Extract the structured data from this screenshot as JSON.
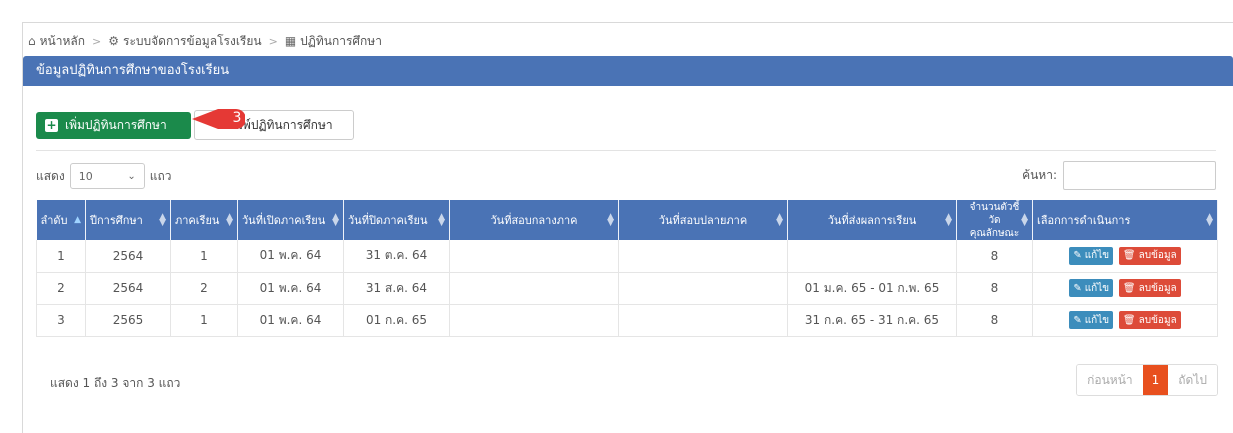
{
  "breadcrumb": [
    {
      "icon": "home-icon",
      "glyph": "⌂",
      "label": "หน้าหลัก"
    },
    {
      "icon": "gears-icon",
      "glyph": "⚙",
      "label": "ระบบจัดการข้อมูลโรงเรียน"
    },
    {
      "icon": "calendar-icon",
      "glyph": "▦",
      "label": "ปฏิทินการศึกษา"
    }
  ],
  "panel": {
    "title": "ข้อมูลปฏิทินการศึกษาของโรงเรียน"
  },
  "toolbar": {
    "add_label": "เพิ่มปฏิทินการศึกษา",
    "print_label": "มพ์ปฏิทินการศึกษา",
    "step_marker": "3"
  },
  "length": {
    "prefix": "แสดง",
    "value": "10",
    "suffix": "แถว"
  },
  "search": {
    "label": "ค้นหา:",
    "value": ""
  },
  "table": {
    "headers": [
      "ลำดับ",
      "ปีการศึกษา",
      "ภาคเรียน",
      "วันที่เปิดภาคเรียน",
      "วันที่ปิดภาคเรียน",
      "วันที่สอบกลางภาค",
      "วันที่สอบปลายภาค",
      "วันที่ส่งผลการเรียน",
      "จำนวนตัวชี้วัด คุณลักษณะ",
      "เลือกการดำเนินการ"
    ],
    "rows": [
      {
        "no": "1",
        "year": "2564",
        "term": "1",
        "open": "01 พ.ค. 64",
        "close": "31 ต.ค. 64",
        "midterm": "",
        "final": "",
        "grade_submit": "",
        "indicators": "8"
      },
      {
        "no": "2",
        "year": "2564",
        "term": "2",
        "open": "01 พ.ค. 64",
        "close": "31 ส.ค. 64",
        "midterm": "",
        "final": "",
        "grade_submit": "01 ม.ค. 65 - 01 ก.พ. 65",
        "indicators": "8"
      },
      {
        "no": "3",
        "year": "2565",
        "term": "1",
        "open": "01 พ.ค. 64",
        "close": "01 ก.ค. 65",
        "midterm": "",
        "final": "",
        "grade_submit": "31 ก.ค. 65 - 31 ก.ค. 65",
        "indicators": "8"
      }
    ],
    "edit_label": "แก้ไข",
    "delete_label": "ลบข้อมูล"
  },
  "info": "แสดง 1 ถึง 3 จาก 3 แถว",
  "pagination": {
    "prev": "ก่อนหน้า",
    "current": "1",
    "next": "ถัดไป"
  },
  "colors": {
    "header": "#4a73b5",
    "add": "#1b8a4b",
    "edit": "#3c8dbc",
    "delete": "#dd4b39",
    "page_active": "#e8501e",
    "marker": "#e53935"
  }
}
